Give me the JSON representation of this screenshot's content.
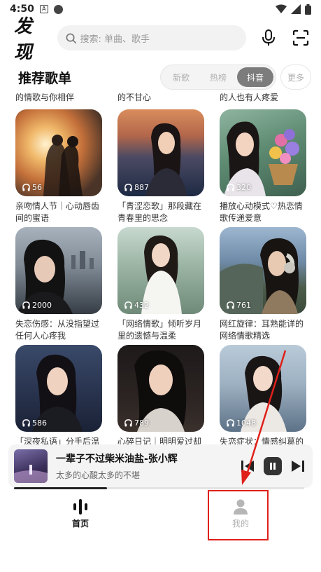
{
  "status_bar": {
    "time": "4:50",
    "a_badge": "A"
  },
  "header": {
    "logo": "发现",
    "search_placeholder": "搜索: 单曲、歌手"
  },
  "section": {
    "title": "推荐歌单",
    "tabs": [
      {
        "label": "新歌",
        "active": false
      },
      {
        "label": "热榜",
        "active": false
      },
      {
        "label": "抖音",
        "active": true
      }
    ],
    "more_label": "更多"
  },
  "previous_row_titles": [
    "的情歌与你相伴",
    "的不甘心",
    "的人也有人疼爱"
  ],
  "playlists": [
    {
      "count": "56",
      "title": "亲吻情人节｜心动唇齿间的蜜语"
    },
    {
      "count": "887",
      "title": "「青涩恋歌」那段藏在青春里的思念"
    },
    {
      "count": "320",
      "title": "播放心动模式♡热恋情歌传递爱意"
    },
    {
      "count": "2000",
      "title": "失恋伤感：从没指望过任何人心疼我"
    },
    {
      "count": "432",
      "title": "「网络情歌」倾听岁月里的遗憾与温柔"
    },
    {
      "count": "761",
      "title": "网红旋律：耳熟能详的网络情歌精选"
    },
    {
      "count": "586",
      "title": "「深夜私语」分手后温柔的告别"
    },
    {
      "count": "789",
      "title": "心碎日记｜明明爱过却不能拥有"
    },
    {
      "count": "1048",
      "title": "失恋症状：情感纠葛的歌单"
    }
  ],
  "now_playing": {
    "song": "一辈子不过柴米油盐-张小辉",
    "lyric": "太多的心酸太多的不堪",
    "progress": 0.32
  },
  "bottom_nav": [
    {
      "label": "首页",
      "active": true
    },
    {
      "label": "我的",
      "active": false
    }
  ],
  "colors": {
    "accent": "#222222",
    "annotation": "#e0201a",
    "inactive": "#b0b0b0"
  }
}
